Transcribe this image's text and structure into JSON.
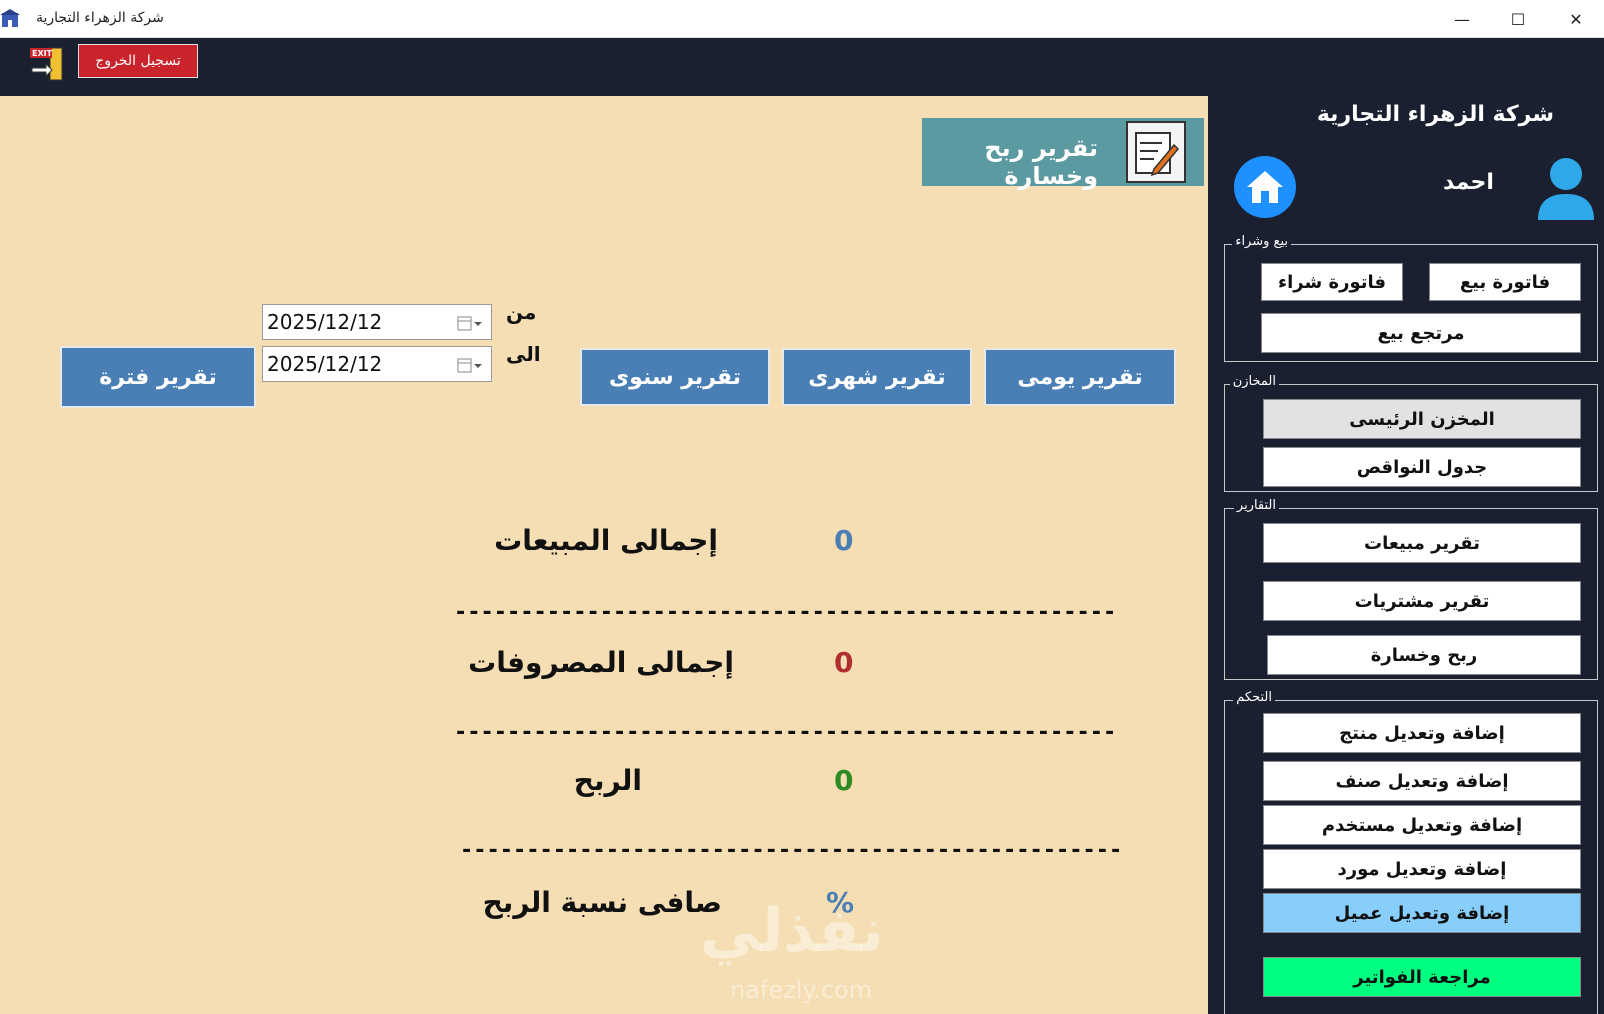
{
  "window": {
    "title": "شركة الزهراء التجارية",
    "minimize": "—",
    "maximize": "☐",
    "close": "✕"
  },
  "header": {
    "logout_label": "تسجيل الخروج"
  },
  "sidebar": {
    "company": "شركة الزهراء التجارية",
    "user_name": "احمد",
    "groups": {
      "sales": {
        "title": "بيع وشراء",
        "sale_invoice": "فاتورة بيع",
        "purchase_invoice": "فاتورة شراء",
        "sale_return": "مرتجع بيع"
      },
      "stores": {
        "title": "المخازن",
        "main_store": "المخزن الرئيسى",
        "shortages": "جدول النواقص"
      },
      "reports": {
        "title": "التقارير",
        "sales_report": "تقرير مبيعات",
        "purchases_report": "تقرير مشتريات",
        "profit_loss": "ربح وخسارة"
      },
      "control": {
        "title": "التحكم",
        "product": "إضافة وتعديل منتج",
        "category": "إضافة وتعديل صنف",
        "user": "إضافة وتعديل مستخدم",
        "supplier": "إضافة وتعديل مورد",
        "customer": "إضافة وتعديل عميل"
      },
      "review_invoices": "مراجعة الفواتير"
    }
  },
  "main": {
    "report_title": "تقرير ربح وخسارة",
    "buttons": {
      "daily": "تقرير يومى",
      "monthly": "تقرير شهرى",
      "yearly": "تقرير سنوى",
      "period": "تقرير فترة"
    },
    "date_from_label": "من",
    "date_to_label": "الى",
    "date_from": "2025/12/12",
    "date_to": "2025/12/12",
    "stats": {
      "total_sales_label": "إجمالى المبيعات",
      "total_sales_value": "0",
      "total_expenses_label": "إجمالى المصروفات",
      "total_expenses_value": "0",
      "profit_label": "الربح",
      "profit_value": "0",
      "net_margin_label": "صافى نسبة الربح",
      "net_margin_value": "%"
    },
    "separator": "----------------------------------------------------",
    "watermark": "نفذلي",
    "watermark_sub": "nafezly.com"
  },
  "colors": {
    "sales_value": "#4a7fb5",
    "expenses_value": "#b03030",
    "profit_value": "#2e8b22",
    "margin_value": "#4a7fb5",
    "sidebar_bg": "#1b2030",
    "main_bg": "#f5deb3",
    "active_button": "#87cefa",
    "review_button": "#00ff80"
  }
}
